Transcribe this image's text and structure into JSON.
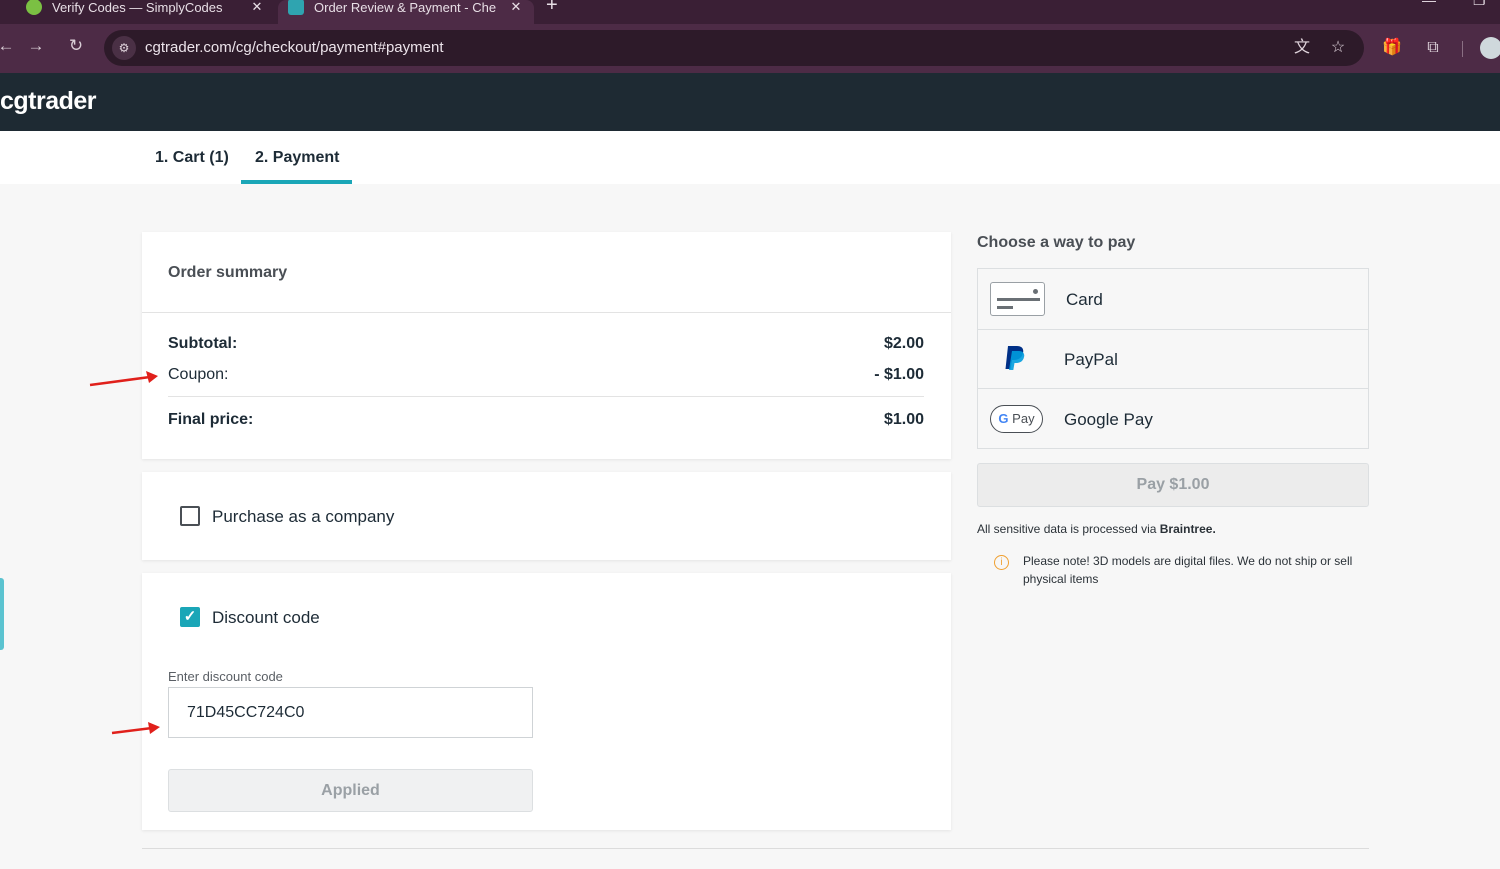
{
  "browser": {
    "tabs": [
      {
        "title": "Verify Codes — SimplyCodes",
        "favicon": "simplycodes-icon",
        "color": "#7bc043"
      },
      {
        "title": "Order Review & Payment - Che",
        "favicon": "cgtrader-tab-icon",
        "color": "#2fa4b0"
      }
    ],
    "close_glyph": "✕",
    "new_tab_glyph": "+",
    "url": "cgtrader.com/cg/checkout/payment#payment"
  },
  "header": {
    "logo": "cgtrader"
  },
  "steps": [
    {
      "label": "1. Cart (1)",
      "active": false
    },
    {
      "label": "2. Payment",
      "active": true
    }
  ],
  "summary": {
    "title": "Order summary",
    "subtotal_label": "Subtotal:",
    "subtotal_value": "$2.00",
    "coupon_label": "Coupon:",
    "coupon_value": "- $1.00",
    "final_label": "Final price:",
    "final_value": "$1.00"
  },
  "company": {
    "label": "Purchase as a company",
    "checked": false
  },
  "discount": {
    "label": "Discount code",
    "checked": true,
    "field_label": "Enter discount code",
    "code": "71D45CC724C0",
    "applied_label": "Applied"
  },
  "payment": {
    "title": "Choose a way to pay",
    "methods": [
      {
        "label": "Card",
        "icon": "credit-card-icon"
      },
      {
        "label": "PayPal",
        "icon": "paypal-icon"
      },
      {
        "label": "Google Pay",
        "icon": "google-pay-icon"
      }
    ],
    "gpay_icon_text": "Pay",
    "pay_button": "Pay $1.00",
    "secure_prefix": "All sensitive data is processed via ",
    "secure_brand": "Braintree.",
    "note": "Please note! 3D models are digital files. We do not ship or sell physical items"
  },
  "colors": {
    "accent": "#1aa6b7",
    "header_bg": "#1e2a33",
    "annotation_arrow": "#e0201b"
  }
}
